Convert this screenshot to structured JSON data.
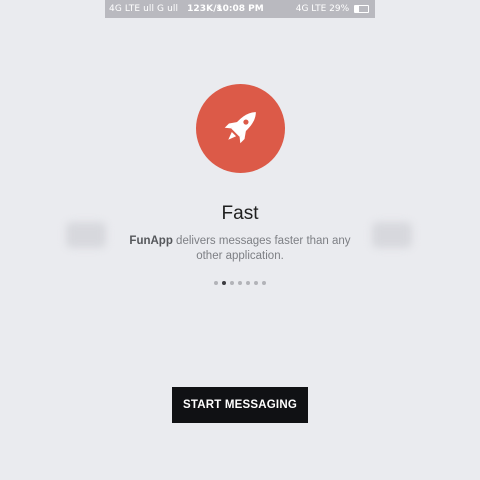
{
  "status_bar": {
    "left_text": "4G LTE ull  G ull",
    "speed": "123K/s",
    "time": "10:08 PM",
    "right_text": "4G LTE 29%",
    "battery_level_percent": 29
  },
  "intro": {
    "icon": "rocket-icon",
    "icon_bg_color": "#dc5a48",
    "title": "Fast",
    "app_name": "FunApp",
    "description_rest": " delivers messages faster than any other application.",
    "page_count": 7,
    "active_page": 2
  },
  "actions": {
    "start_label": "START MESSAGING"
  }
}
